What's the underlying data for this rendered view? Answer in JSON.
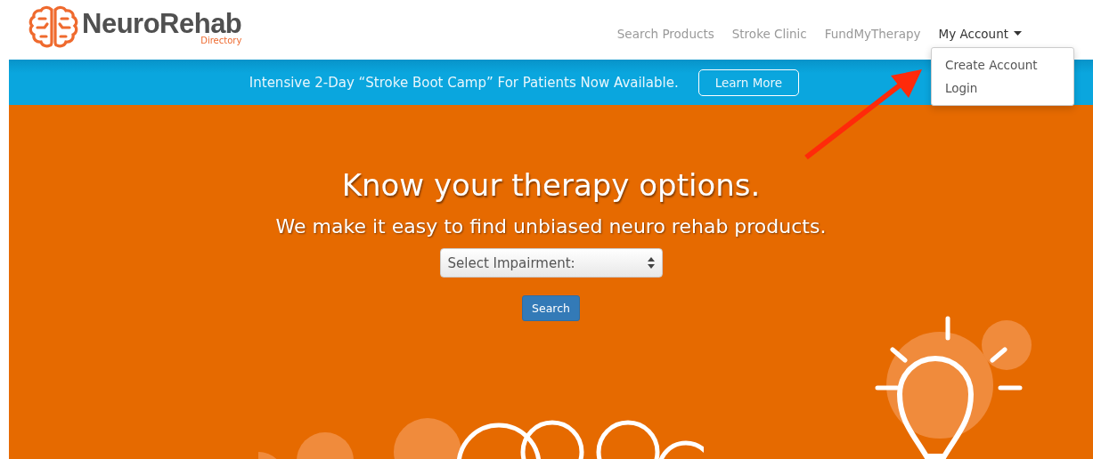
{
  "logo": {
    "name": "NeuroRehab",
    "subtitle": "Directory"
  },
  "nav": [
    {
      "label": "Search Products",
      "kind": "link"
    },
    {
      "label": "Stroke Clinic",
      "kind": "link"
    },
    {
      "label": "FundMyTherapy",
      "kind": "link"
    },
    {
      "label": "My Account",
      "kind": "dropdown",
      "expanded": true,
      "menu": [
        "Create Account",
        "Login"
      ]
    }
  ],
  "banner": {
    "text": "Intensive 2-Day “Stroke Boot Camp” For Patients Now Available.",
    "button": "Learn More"
  },
  "hero": {
    "title": "Know your therapy options.",
    "subtitle": "We make it easy to find unbiased neuro rehab products.",
    "select": {
      "placeholder": "Select Impairment:"
    },
    "button": "Search"
  }
}
